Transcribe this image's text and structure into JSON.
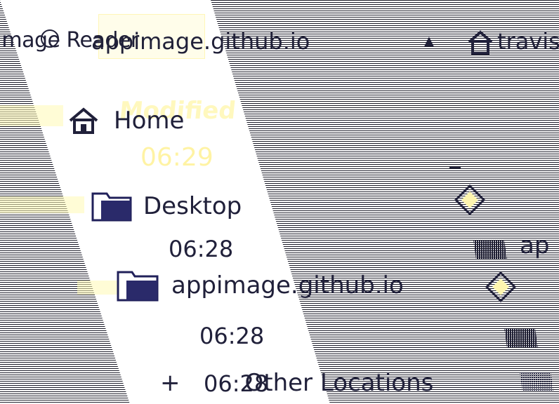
{
  "title_bar": {
    "window_title": "Image Reader",
    "current_path": "appimage.github.io",
    "right_location": "travis"
  },
  "sidebar": {
    "header_label": "Modified",
    "items": [
      {
        "label": "Home",
        "time": "06:29",
        "icon": "home-icon"
      },
      {
        "label": "Desktop",
        "time": "06:28",
        "icon": "folder-icon"
      },
      {
        "label": "appimage.github.io",
        "time": "06:28",
        "icon": "folder-icon"
      },
      {
        "label": "Other Locations",
        "time": "06:28",
        "icon": "plus-icon"
      }
    ]
  },
  "right_panel": {
    "partial_label": "ap",
    "icons": [
      "drive-icon",
      "drive-icon",
      "file-icon",
      "file-icon",
      "file-icon"
    ]
  },
  "colors": {
    "text": "#20203a",
    "background_stripes": "#1b1b28",
    "ghost_yellow": "#fff9a8"
  }
}
